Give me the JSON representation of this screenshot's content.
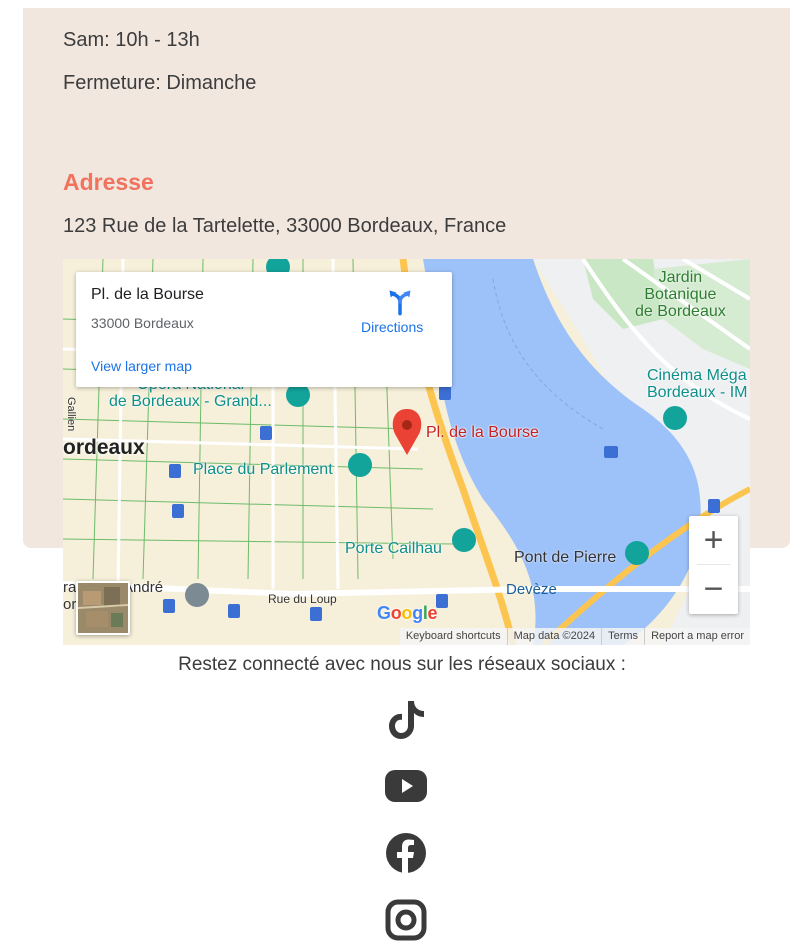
{
  "hours": {
    "saturday": "Sam: 10h - 13h",
    "closed": "Fermeture: Dimanche"
  },
  "address_section": {
    "title": "Adresse",
    "address": "123 Rue de la Tartelette, 33000 Bordeaux, France"
  },
  "map": {
    "info_card": {
      "title": "Pl. de la Bourse",
      "subtitle": "33000 Bordeaux",
      "directions_label": "Directions",
      "larger_map_link": "View larger map"
    },
    "labels": {
      "jardin": "Jardin\nBotanique\nde Bordeaux",
      "cinema": "Cinéma Méga\nBordeaux - IM",
      "opera": "Opéra National\nde Bordeaux -  Grand...",
      "city": "ordeaux",
      "parlement": "Place du Parlement",
      "bourse": "Pl. de la Bourse",
      "cailhau": "Porte Cailhau",
      "pont": "Pont de Pierre",
      "deveze": "Devèze",
      "andre": "ral Saint-André\nordeaux",
      "loup": "Rue du Loup",
      "gallien": "Gallien"
    },
    "zoom_in": "+",
    "zoom_out": "−",
    "logo": "Google",
    "attribution": {
      "shortcuts": "Keyboard shortcuts",
      "data": "Map data ©2024",
      "terms": "Terms",
      "report": "Report a map error"
    },
    "colors": {
      "water": "#9dc1f9",
      "land": "#f6efd9",
      "park": "#c9e7c5",
      "road_major": "#fbc54f"
    }
  },
  "social": {
    "prompt": "Restez connecté avec nous sur les réseaux sociaux :",
    "icons": [
      "tiktok-icon",
      "youtube-icon",
      "facebook-icon",
      "instagram-icon"
    ]
  },
  "colors": {
    "card_bg": "#f1e7df",
    "accent": "#f2725e",
    "text": "#3c3c3c"
  }
}
